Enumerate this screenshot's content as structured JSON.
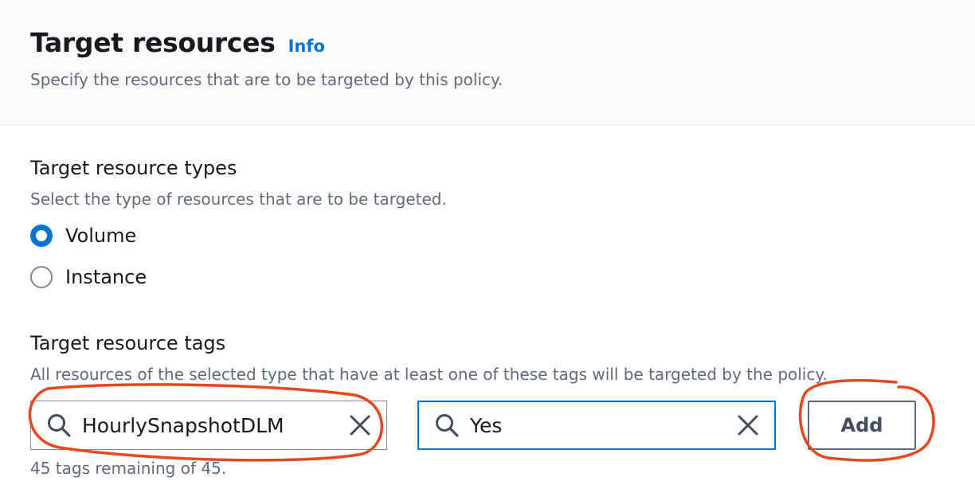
{
  "header": {
    "title": "Target resources",
    "info_link": "Info",
    "subtitle": "Specify the resources that are to be targeted by this policy."
  },
  "resource_types": {
    "label": "Target resource types",
    "description": "Select the type of resources that are to be targeted.",
    "options": [
      {
        "label": "Volume",
        "checked": true
      },
      {
        "label": "Instance",
        "checked": false
      }
    ]
  },
  "resource_tags": {
    "label": "Target resource tags",
    "description": "All resources of the selected type that have at least one of these tags will be targeted by the policy.",
    "key_value": "HourlySnapshotDLM",
    "value_value": "Yes",
    "add_label": "Add",
    "remaining": "45 tags remaining of 45."
  },
  "colors": {
    "accent": "#0972d3",
    "annotation": "#e5481e",
    "text": "#16191f",
    "muted": "#5f6b7a"
  },
  "icons": {
    "search": "search-icon",
    "clear": "close-icon"
  }
}
